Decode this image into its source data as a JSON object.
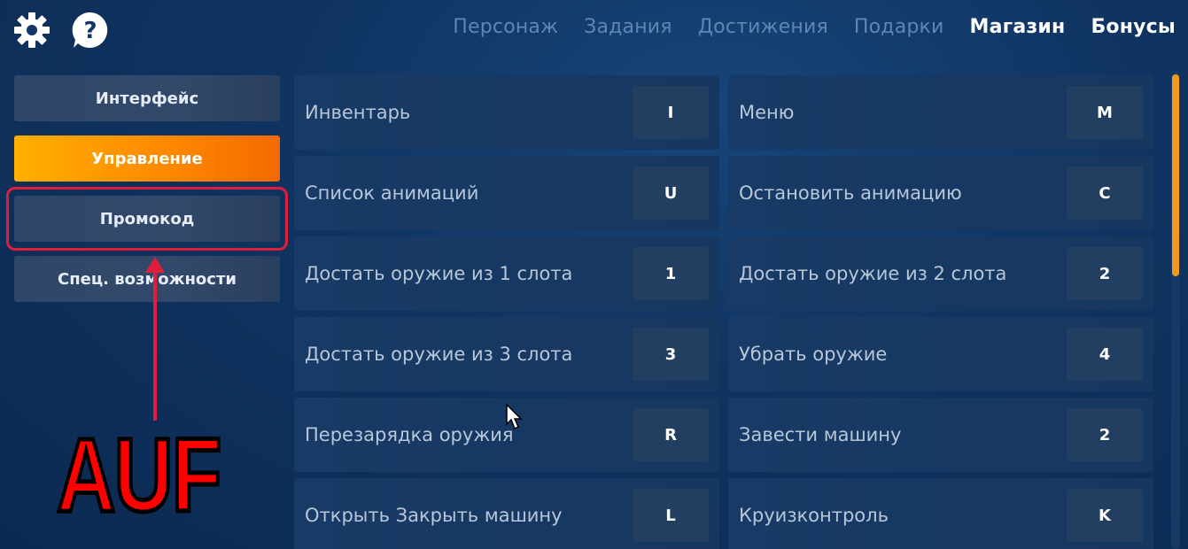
{
  "header": {
    "icons": {
      "settings": "gear-icon",
      "help": "question-icon"
    },
    "nav": [
      {
        "label": "Персонаж",
        "active": false
      },
      {
        "label": "Задания",
        "active": false
      },
      {
        "label": "Достижения",
        "active": false
      },
      {
        "label": "Подарки",
        "active": false
      },
      {
        "label": "Магазин",
        "active": true
      },
      {
        "label": "Бонусы",
        "active": true
      }
    ]
  },
  "sidebar": {
    "items": [
      {
        "label": "Интерфейс",
        "active": false
      },
      {
        "label": "Управление",
        "active": true
      },
      {
        "label": "Промокод",
        "active": false
      },
      {
        "label": "Спец. возможности",
        "active": false
      }
    ]
  },
  "keybinds": {
    "left": [
      {
        "label": "Инвентарь",
        "key": "I"
      },
      {
        "label": "Список анимаций",
        "key": "U"
      },
      {
        "label": "Достать оружие из 1 слота",
        "key": "1"
      },
      {
        "label": "Достать оружие из 3 слота",
        "key": "3"
      },
      {
        "label": "Перезарядка оружия",
        "key": "R"
      },
      {
        "label": "Открыть Закрыть машину",
        "key": "L"
      }
    ],
    "right": [
      {
        "label": "Меню",
        "key": "M"
      },
      {
        "label": "Остановить анимацию",
        "key": "C"
      },
      {
        "label": "Достать оружие из 2 слота",
        "key": "2"
      },
      {
        "label": "Убрать оружие",
        "key": "4"
      },
      {
        "label": "Завести машину",
        "key": "2"
      },
      {
        "label": "Круизконтроль",
        "key": "K"
      }
    ]
  },
  "annotation": {
    "text": "AUF",
    "color": "#ff0000"
  },
  "colors": {
    "accent": "#ff9500",
    "nav_inactive": "#5e86b6",
    "highlight": "#e01e3c"
  }
}
